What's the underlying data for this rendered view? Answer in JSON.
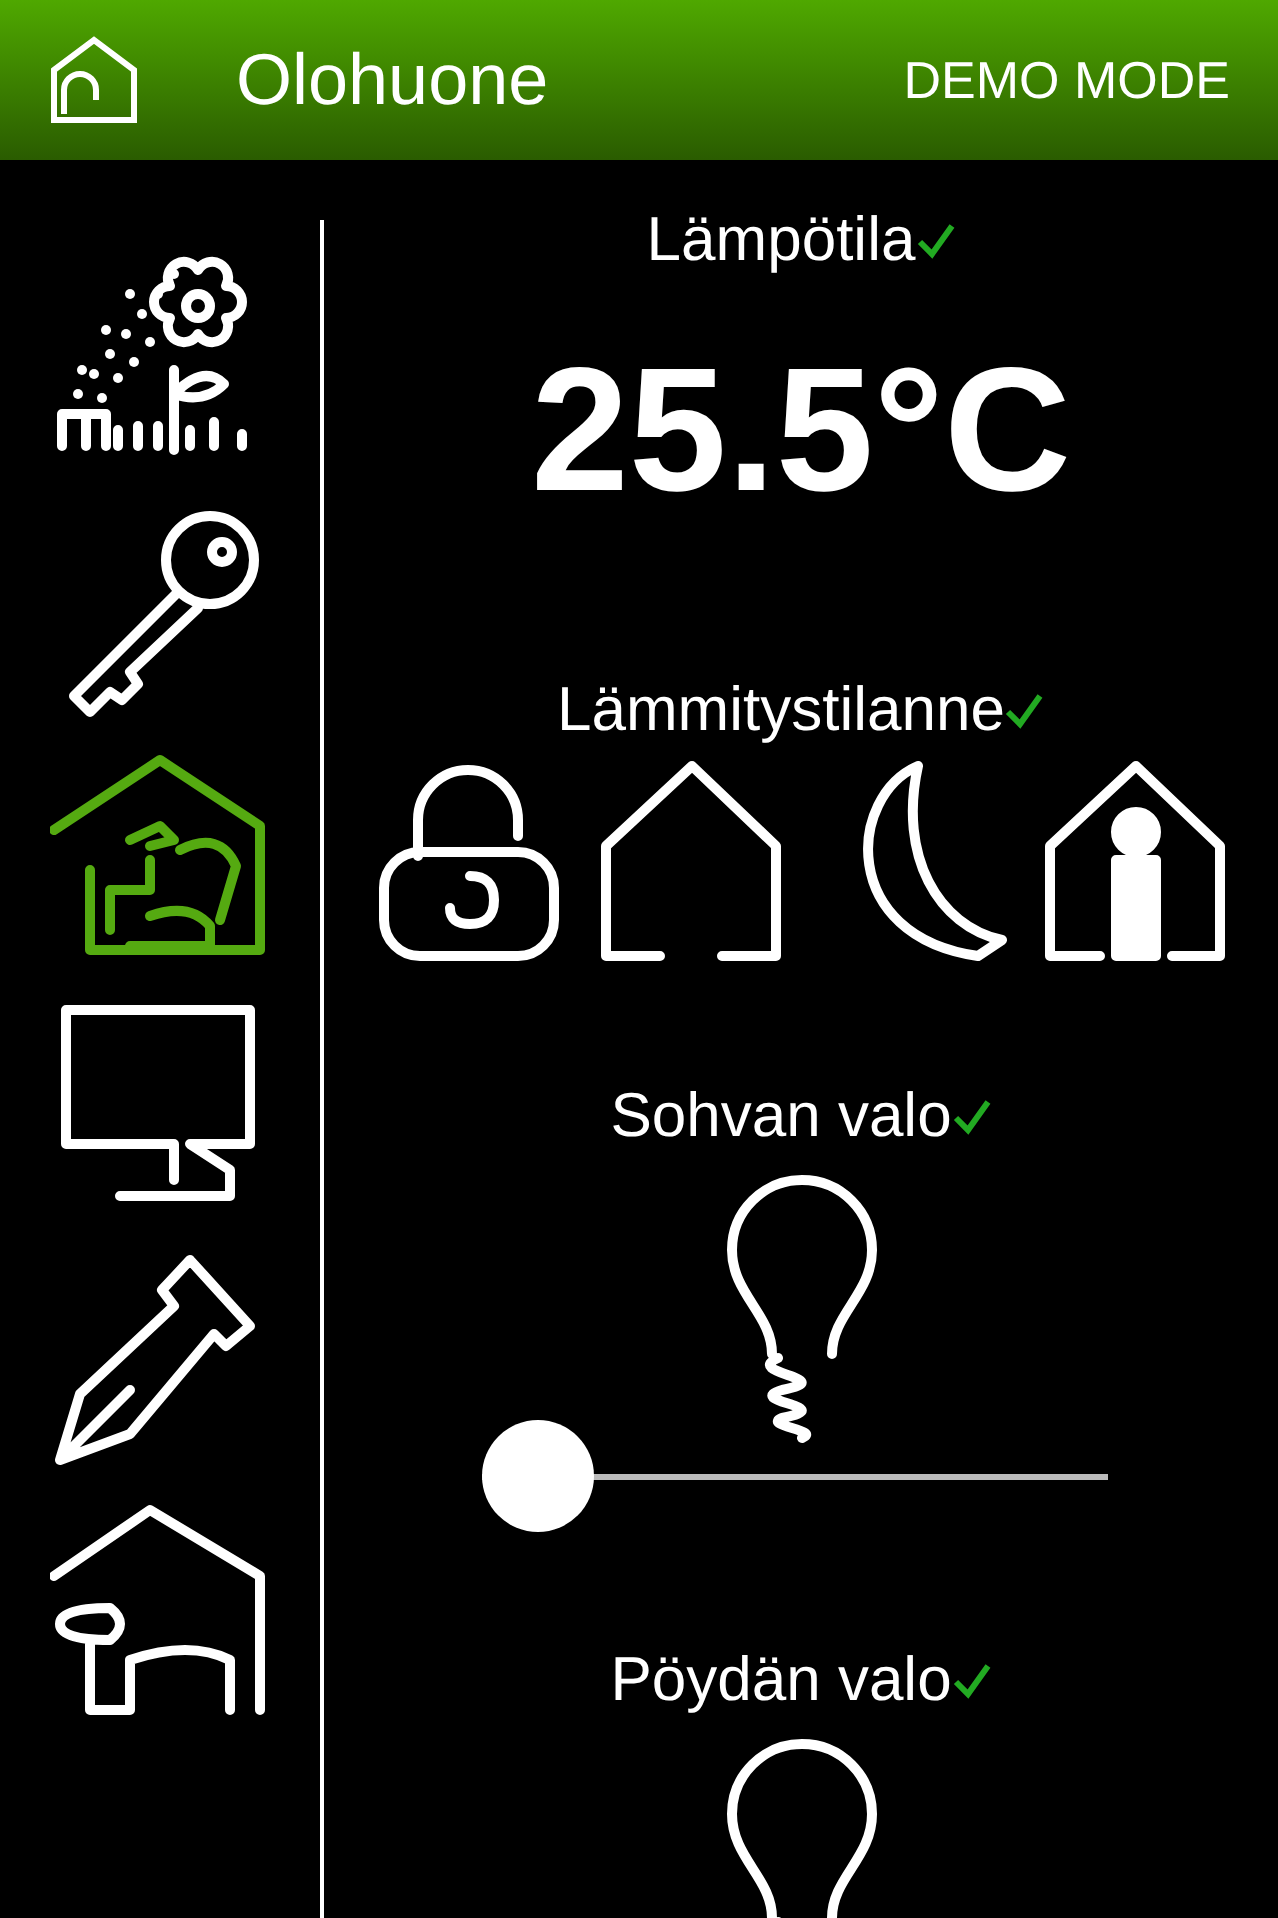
{
  "header": {
    "title": "Olohuone",
    "mode": "DEMO MODE"
  },
  "sidebar": {
    "items": [
      {
        "kind": "garden",
        "selected": false
      },
      {
        "kind": "key",
        "selected": false
      },
      {
        "kind": "living-room",
        "selected": true
      },
      {
        "kind": "monitor",
        "selected": false
      },
      {
        "kind": "pen",
        "selected": false
      },
      {
        "kind": "bath",
        "selected": false
      }
    ]
  },
  "controls": [
    {
      "kind": "reading",
      "label": "Lämpötila",
      "confirmed": true,
      "value": "25.5°C"
    },
    {
      "kind": "modes",
      "label": "Lämmitystilanne",
      "confirmed": true,
      "modes": [
        {
          "kind": "unlocked"
        },
        {
          "kind": "home"
        },
        {
          "kind": "night"
        },
        {
          "kind": "present"
        }
      ]
    },
    {
      "kind": "light",
      "label": "Sohvan valo",
      "confirmed": true,
      "level": 0
    },
    {
      "kind": "light-cut",
      "label": "Pöydän valo",
      "confirmed": true
    }
  ]
}
